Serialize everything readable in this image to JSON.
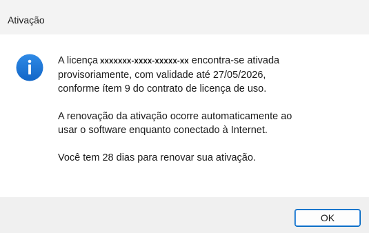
{
  "window": {
    "title": "Ativação"
  },
  "icon": {
    "name": "info-icon",
    "color": "#1a73d9"
  },
  "message": {
    "line1_prefix": "A licença",
    "license_key": "xxxxxxx-xxxx-xxxxx-xx",
    "line1_suffix": "encontra-se ativada",
    "line2": "provisoriamente, com validade até 27/05/2026,",
    "line3": "conforme ítem 9 do contrato de licença de uso.",
    "para2_line1": "A renovação da ativação ocorre automaticamente ao",
    "para2_line2": "usar o software enquanto conectado à Internet.",
    "para3": "Você tem 28 dias para renovar sua ativação."
  },
  "buttons": {
    "ok_label": "OK"
  }
}
